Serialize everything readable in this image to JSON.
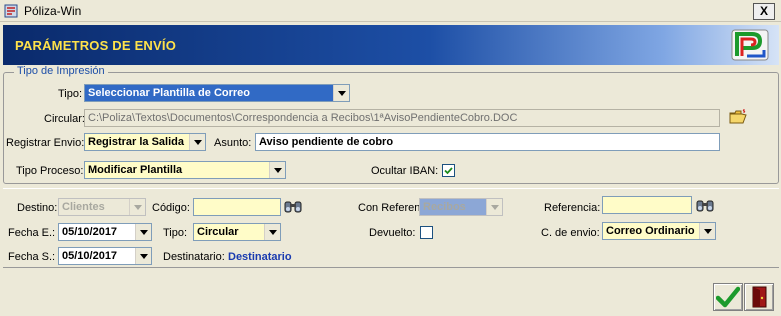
{
  "window": {
    "title": "Póliza-Win",
    "close_glyph": "X"
  },
  "banner": {
    "title": "PARÁMETROS DE ENVÍO"
  },
  "group": {
    "legend": "Tipo de Impresión"
  },
  "form": {
    "tipo_label": "Tipo:",
    "tipo_value": "Seleccionar Plantilla de Correo",
    "circular_label": "Circular:",
    "circular_value": "C:\\Poliza\\Textos\\Documentos\\Correspondencia a Recibos\\1ªAvisoPendienteCobro.DOC",
    "registrar_label": "Registrar Envio:",
    "registrar_value": "Registrar la Salida",
    "asunto_label": "Asunto:",
    "asunto_value": "Aviso pendiente de cobro",
    "tipo_proceso_label": "Tipo Proceso:",
    "tipo_proceso_value": "Modificar Plantilla",
    "ocultar_iban_label": "Ocultar IBAN:",
    "ocultar_iban_checked": true
  },
  "envio": {
    "destino_label": "Destino:",
    "destino_value": "Clientes",
    "codigo_label": "Código:",
    "codigo_value": "",
    "con_ref_label": "Con Referencia a:",
    "con_ref_value": "Recibos",
    "referencia_label": "Referencia:",
    "referencia_value": "",
    "fecha_e_label": "Fecha E.:",
    "fecha_e_value": "05/10/2017",
    "tipo_label": "Tipo:",
    "tipo_value": "Circular",
    "devuelto_label": "Devuelto:",
    "devuelto_checked": false,
    "c_envio_label": "C. de envio:",
    "c_envio_value": "Correo Ordinario",
    "fecha_s_label": "Fecha S.:",
    "fecha_s_value": "05/10/2017",
    "destinatario_label": "Destinatario:",
    "destinatario_value": "Destinatario"
  },
  "colors": {
    "accent": "#316ac5",
    "banner_text": "#ffe24a",
    "legend": "#1e4fa8",
    "highlight_field": "#fffcc8"
  },
  "icons": [
    "app-icon",
    "close-icon",
    "logo-icon",
    "folder-open-icon",
    "binoculars-icon",
    "chevron-down-icon",
    "checkmark-icon",
    "exit-door-icon"
  ]
}
